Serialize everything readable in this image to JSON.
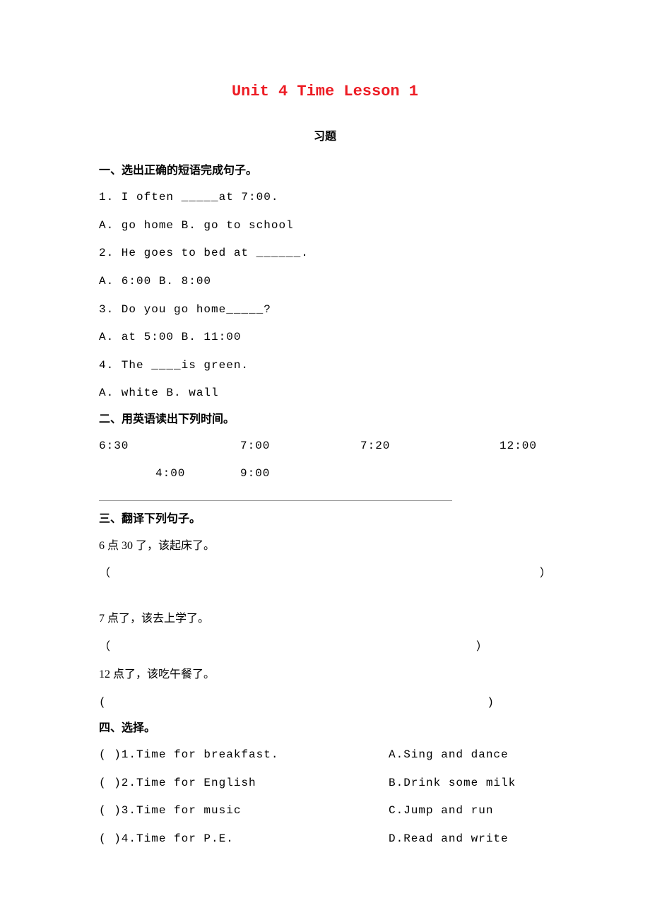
{
  "title": "Unit 4 Time Lesson 1",
  "subtitle": "习题",
  "section1": {
    "heading": "一、选出正确的短语完成句子。",
    "q1": "1.  I  often   _____at  7:00.",
    "q1opt": "A.  go  home   B.  go  to  school",
    "q2": "2.  He  goes  to  bed  at  ______.",
    "q2opt": "A.  6:00    B.  8:00",
    "q3": "3.  Do  you  go  home_____?",
    "q3opt": "A.  at  5:00   B.  11:00",
    "q4": "4.  The  ____is  green.",
    "q4opt": "  A.  white    B.  wall"
  },
  "section2": {
    "heading": "二、用英语读出下列时间。",
    "t1": "6:30",
    "t2": "7:00",
    "t3": "7:20",
    "t4": "12:00",
    "t5": "4:00",
    "t6": "9:00"
  },
  "section3": {
    "heading": "三、翻译下列句子。",
    "s1": "6 点 30 了，该起床了。",
    "s2": "7 点了，该去上学了。",
    "s3": "12 点了，该吃午餐了。",
    "paren_open": "（",
    "paren_close": "）",
    "paren_open2": "(",
    "paren_close2": ")"
  },
  "section4": {
    "heading": "四、选择。",
    "rows": [
      {
        "left": "(        )1.Time  for  breakfast.",
        "right": "A.Sing  and  dance"
      },
      {
        "left": "(        )2.Time  for  English",
        "right": " B.Drink  some  milk"
      },
      {
        "left": "  (       )3.Time  for  music",
        "right": "   C.Jump  and  run"
      },
      {
        "left": "(        )4.Time  for  P.E.",
        "right": "    D.Read  and  write"
      }
    ]
  }
}
